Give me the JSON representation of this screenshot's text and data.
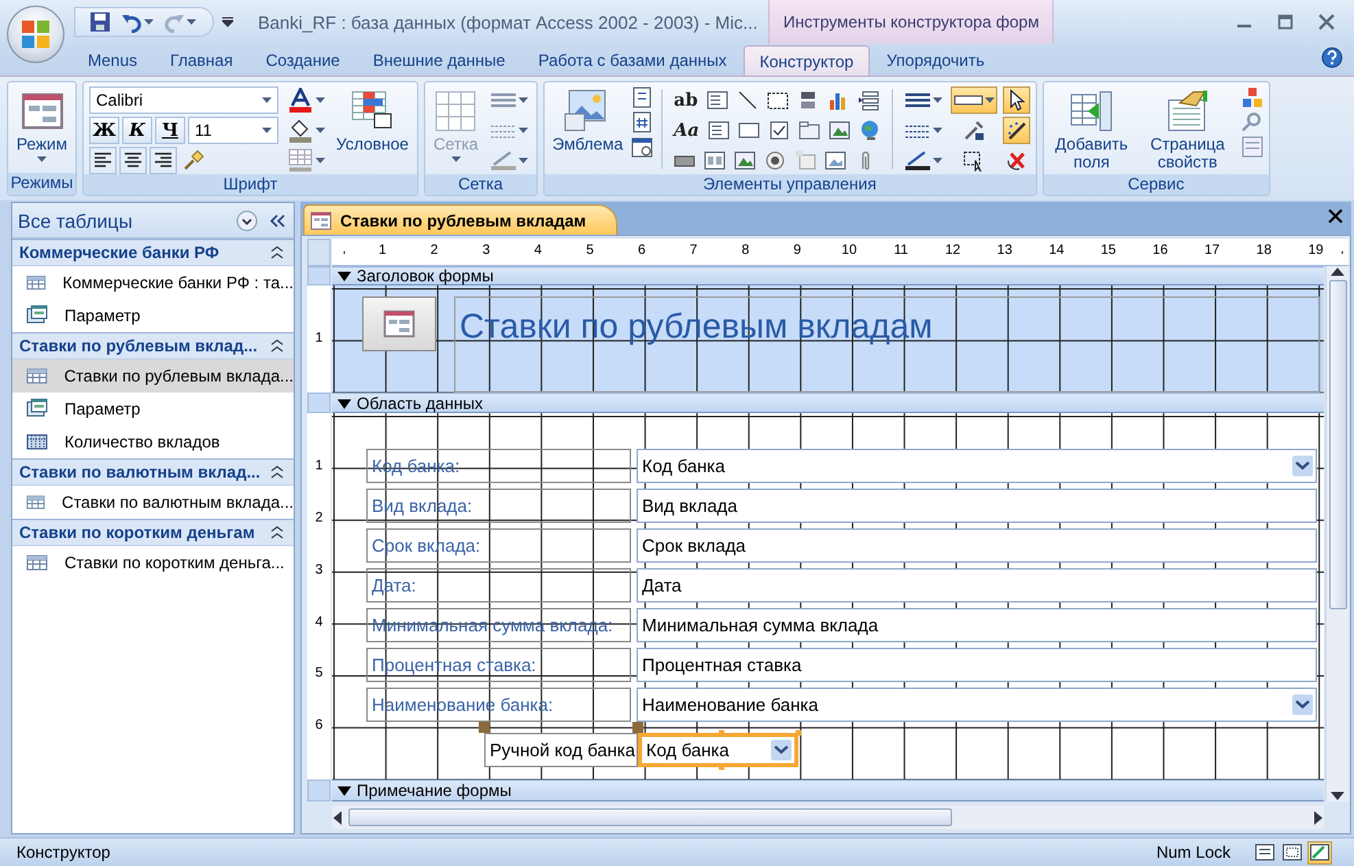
{
  "window": {
    "title": "Banki_RF : база данных (формат Access 2002 - 2003) - Mic...",
    "contextual_group": "Инструменты конструктора форм"
  },
  "ribbon_tabs": [
    {
      "label": "Menus",
      "selected": false
    },
    {
      "label": "Главная",
      "selected": false
    },
    {
      "label": "Создание",
      "selected": false
    },
    {
      "label": "Внешние данные",
      "selected": false
    },
    {
      "label": "Работа с базами данных",
      "selected": false
    },
    {
      "label": "Конструктор",
      "selected": true
    },
    {
      "label": "Упорядочить",
      "selected": false
    }
  ],
  "ribbon": {
    "views": {
      "group": "Режимы",
      "button": "Режим"
    },
    "font": {
      "group": "Шрифт",
      "font_name": "Calibri",
      "font_size": "11",
      "bold": "Ж",
      "italic": "К",
      "underline": "Ч",
      "conditional": "Условное"
    },
    "grid": {
      "group": "Сетка",
      "button": "Сетка",
      "disabled": true
    },
    "controls": {
      "group": "Элементы управления",
      "logo": "Эмблема",
      "text_box_glyph": "ab",
      "label_glyph": "Aa",
      "toggles": [
        {
          "kind": "style",
          "selected": true
        },
        {
          "kind": "pointer",
          "selected": true
        },
        {
          "kind": "wizard",
          "selected": true
        }
      ]
    },
    "service": {
      "group": "Сервис",
      "add_fields": "Добавить поля",
      "property_sheet": "Страница свойств"
    }
  },
  "navigation": {
    "title": "Все таблицы",
    "groups": [
      {
        "title": "Коммерческие банки РФ",
        "expanded": true,
        "items": [
          {
            "label": "Коммерческие банки РФ : та...",
            "kind": "table",
            "selected": false
          },
          {
            "label": "Параметр",
            "kind": "form",
            "selected": false
          }
        ]
      },
      {
        "title": "Ставки по рублевым вклад...",
        "expanded": true,
        "items": [
          {
            "label": "Ставки по рублевым вклада...",
            "kind": "table",
            "selected": true
          },
          {
            "label": "Параметр",
            "kind": "form",
            "selected": false
          },
          {
            "label": "Количество вкладов",
            "kind": "report",
            "selected": false
          }
        ]
      },
      {
        "title": "Ставки по валютным вклад...",
        "expanded": true,
        "items": [
          {
            "label": "Ставки по валютным вклада...",
            "kind": "table",
            "selected": false
          }
        ]
      },
      {
        "title": "Ставки по коротким деньгам",
        "expanded": true,
        "items": [
          {
            "label": "Ставки по коротким деньга...",
            "kind": "table",
            "selected": false
          }
        ]
      }
    ]
  },
  "document": {
    "tab": "Ставки по рублевым вкладам",
    "ruler": [
      "1",
      "2",
      "3",
      "4",
      "5",
      "6",
      "7",
      "8",
      "9",
      "10",
      "11",
      "12",
      "13",
      "14",
      "15",
      "16",
      "17",
      "18",
      "19"
    ],
    "header": {
      "title": "Заголовок формы",
      "ruler": [
        "1"
      ],
      "form_title": "Ставки по рублевым вкладам"
    },
    "detail": {
      "title": "Область данных",
      "ruler": [
        "1",
        "2",
        "3",
        "4",
        "5",
        "6"
      ],
      "fields": [
        {
          "label": "Код банка:",
          "control": "Код банка",
          "kind": "combo",
          "selected": false
        },
        {
          "label": "Вид вклада:",
          "control": "Вид вклада",
          "kind": "text",
          "selected": false
        },
        {
          "label": "Срок вклада:",
          "control": "Срок вклада",
          "kind": "text",
          "selected": false
        },
        {
          "label": "Дата:",
          "control": "Дата",
          "kind": "text",
          "selected": false
        },
        {
          "label": "Минимальная сумма вклада:",
          "control": "Минимальная сумма вклада",
          "kind": "text",
          "selected": false
        },
        {
          "label": "Процентная ставка:",
          "control": "Процентная ставка",
          "kind": "text",
          "selected": false
        },
        {
          "label": "Наименование банка:",
          "control": "Наименование банка",
          "kind": "combo",
          "selected": false
        }
      ],
      "extra_pair": {
        "label": "Ручной код банка",
        "control": "Код банка",
        "kind": "combo",
        "selected": true
      }
    },
    "footer": {
      "title": "Примечание формы"
    }
  },
  "status_bar": {
    "mode": "Конструктор",
    "num_lock": "Num Lock",
    "views": [
      {
        "kind": "form",
        "selected": false
      },
      {
        "kind": "layout",
        "selected": false
      },
      {
        "kind": "design",
        "selected": true
      }
    ]
  }
}
